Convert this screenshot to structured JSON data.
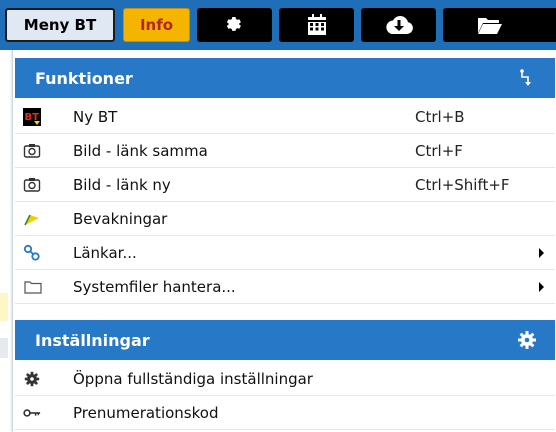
{
  "toolbar": {
    "meny_label": "Meny BT",
    "info_label": "Info",
    "icon_buttons": [
      "gear-icon",
      "calendar-icon",
      "cloud-download-icon",
      "folder-open-icon"
    ],
    "colors": {
      "bar": "#1e6fb8",
      "info_bg": "#f5b400",
      "info_text": "#b3261e",
      "icon_bg": "#000000"
    }
  },
  "menu": {
    "sections": [
      {
        "title": "Funktioner",
        "icon": "branch-arrow-icon",
        "items": [
          {
            "label": "Ny BT",
            "shortcut": "Ctrl+B",
            "icon": "bt-logo-icon"
          },
          {
            "label": "Bild - länk samma",
            "shortcut": "Ctrl+F",
            "icon": "camera-icon"
          },
          {
            "label": "Bild - länk ny",
            "shortcut": "Ctrl+Shift+F",
            "icon": "camera-icon"
          },
          {
            "label": "Bevakningar",
            "shortcut": "",
            "icon": "flag-icon"
          },
          {
            "label": "Länkar...",
            "shortcut": "",
            "icon": "link-icon",
            "submenu": true
          },
          {
            "label": "Systemfiler hantera...",
            "shortcut": "",
            "icon": "folder-icon",
            "submenu": true
          }
        ]
      },
      {
        "title": "Inställningar",
        "icon": "gear-icon",
        "items": [
          {
            "label": "Öppna fullständiga inställningar",
            "shortcut": "",
            "icon": "gear-icon"
          },
          {
            "label": "Prenumerationskod",
            "shortcut": "",
            "icon": "key-icon"
          }
        ]
      }
    ],
    "colors": {
      "section_header": "#2878c8"
    }
  }
}
